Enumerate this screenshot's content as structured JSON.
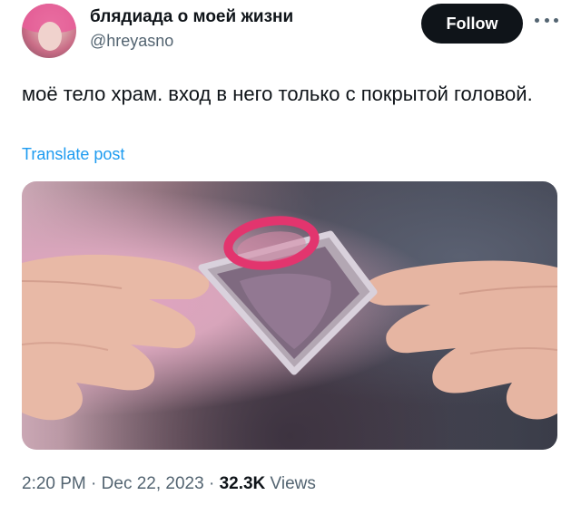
{
  "author": {
    "display_name": "блядиада о моей жизни",
    "handle": "@hreyasno"
  },
  "follow_label": "Follow",
  "tweet": {
    "text": "моё тело храм. вход в него только с покрытой головой.",
    "translate_label": "Translate post"
  },
  "meta": {
    "time": "2:20 PM",
    "separator": " · ",
    "date": "Dec 22, 2023",
    "views_count": "32.3K",
    "views_label": " Views"
  },
  "colors": {
    "link": "#1d9bf0",
    "secondary_text": "#536471",
    "button_bg": "#0f1419"
  },
  "icons": {
    "more": "more-horizontal-icon"
  }
}
